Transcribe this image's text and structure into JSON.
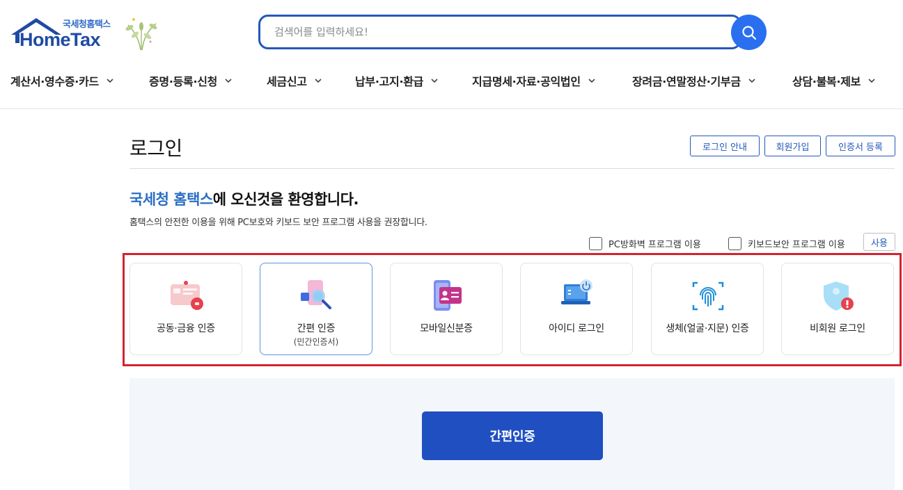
{
  "header": {
    "logo_sub": "국세청홈택스",
    "logo_main": "HomeTax",
    "search_placeholder": "검색어를 입력하세요!",
    "nav": [
      {
        "label": "계산서·영수증·카드"
      },
      {
        "label": "증명·등록·신청"
      },
      {
        "label": "세금신고"
      },
      {
        "label": "납부·고지·환급"
      },
      {
        "label": "지급명세·자료·공익법인"
      },
      {
        "label": "장려금·연말정산·기부금"
      },
      {
        "label": "상담·불복·제보"
      }
    ]
  },
  "main": {
    "title": "로그인",
    "top_buttons": [
      {
        "label": "로그인 안내"
      },
      {
        "label": "회원가입"
      },
      {
        "label": "인증서 등록"
      }
    ],
    "welcome_highlight": "국세청 홈택스",
    "welcome_rest": "에 오신것을 환영합니다.",
    "welcome_sub": "홈택스의 안전한 이용을 위해 PC보호와 키보드 보안 프로그램 사용을 권장합니다.",
    "checkboxes": [
      {
        "label": "PC방화벽 프로그램 이용",
        "checked": false
      },
      {
        "label": "키보드보안 프로그램 이용",
        "checked": false
      }
    ],
    "use_button": "사용",
    "login_methods": [
      {
        "label": "공동·금융 인증",
        "sub": "",
        "icon": "certificate-card-icon",
        "selected": false
      },
      {
        "label": "간편 인증",
        "sub": "(민간인증서)",
        "icon": "simple-auth-search-icon",
        "selected": true
      },
      {
        "label": "모바일신분증",
        "sub": "",
        "icon": "mobile-id-icon",
        "selected": false
      },
      {
        "label": "아이디 로그인",
        "sub": "",
        "icon": "laptop-power-icon",
        "selected": false
      },
      {
        "label": "생체(얼굴·지문) 인증",
        "sub": "",
        "icon": "fingerprint-icon",
        "selected": false
      },
      {
        "label": "비회원 로그인",
        "sub": "",
        "icon": "shield-guest-icon",
        "selected": false
      }
    ],
    "action_button": "간편인증"
  },
  "colors": {
    "primary": "#1f4fc0",
    "accent_text": "#2a6ec4",
    "search_border": "#2458b8",
    "highlight_border": "#d2232e",
    "panel_bg": "#f3f6fb"
  }
}
